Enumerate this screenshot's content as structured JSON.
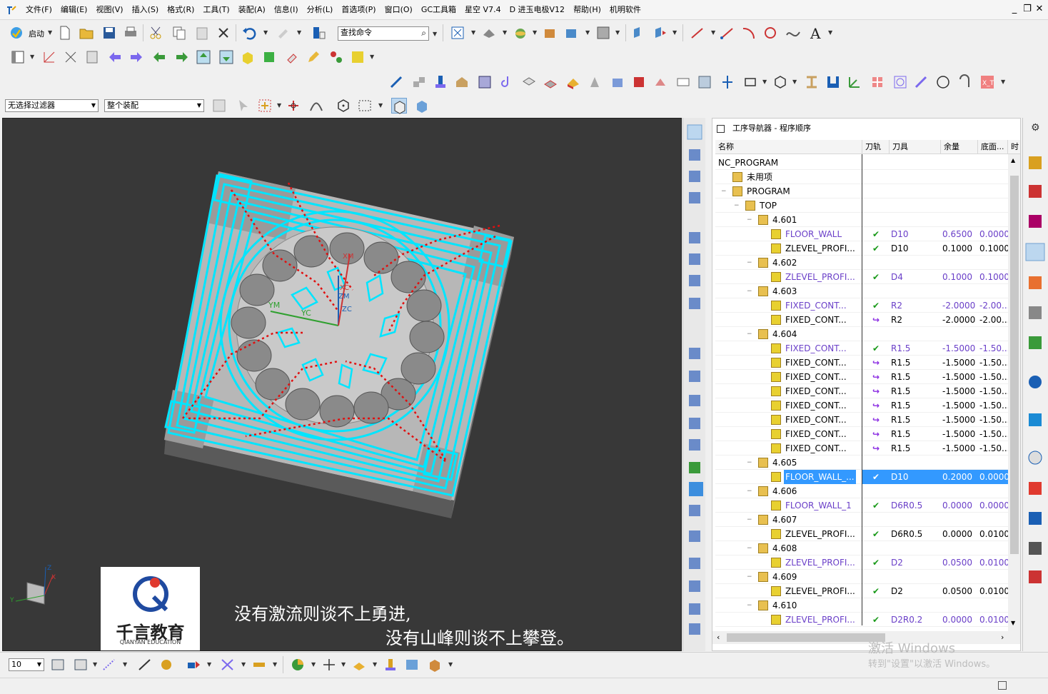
{
  "menu": {
    "items": [
      "文件(F)",
      "编辑(E)",
      "视图(V)",
      "插入(S)",
      "格式(R)",
      "工具(T)",
      "装配(A)",
      "信息(I)",
      "分析(L)",
      "首选项(P)",
      "窗口(O)",
      "GC工具箱",
      "星空 V7.4",
      "D 进玉电极V12",
      "帮助(H)",
      "机明软件"
    ],
    "window_controls": [
      "_",
      "❐",
      "✕"
    ]
  },
  "toolbar": {
    "start_label": "启动",
    "search_placeholder": "查找命令",
    "selection_filter": "无选择过滤器",
    "assembly_scope": "整个装配"
  },
  "viewport": {
    "axis_labels": {
      "xm": "XM",
      "ym": "YM",
      "yc": "YC",
      "xc": "XC",
      "zm": "ZM",
      "zc": "ZC"
    },
    "triad": {
      "x": "X",
      "y": "Y",
      "z": "Z"
    },
    "subtitle_line1": "没有激流则谈不上勇进,",
    "subtitle_line2": "没有山峰则谈不上攀登。",
    "logo_name": "千言教育",
    "logo_en": "QIANYAN EDUCATION",
    "colors": {
      "background": "#383838",
      "part": "#b4b4b4",
      "toolpath": "#00e5ff",
      "rapid": "#e01010"
    }
  },
  "navigator": {
    "title": "工序导航器 - 程序顺序",
    "columns": [
      "名称",
      "刀轨",
      "刀具",
      "余量",
      "底面...",
      "时"
    ],
    "rows": [
      {
        "level": 0,
        "type": "root",
        "name": "NC_PROGRAM",
        "check": "",
        "tool": "",
        "stock": "",
        "floor": ""
      },
      {
        "level": 1,
        "type": "group",
        "name": "未用项",
        "check": "",
        "tool": "",
        "stock": "",
        "floor": ""
      },
      {
        "level": 1,
        "type": "program",
        "name": "PROGRAM",
        "check": "",
        "tool": "",
        "stock": "",
        "floor": ""
      },
      {
        "level": 2,
        "type": "program",
        "name": "TOP",
        "check": "",
        "tool": "",
        "stock": "",
        "floor": ""
      },
      {
        "level": 3,
        "type": "program",
        "name": "4.601",
        "check": "",
        "tool": "",
        "stock": "",
        "floor": ""
      },
      {
        "level": 4,
        "type": "op",
        "name": "FLOOR_WALL",
        "check": "ok",
        "tool": "D10",
        "stock": "0.6500",
        "floor": "0.0000",
        "purple": true
      },
      {
        "level": 4,
        "type": "op",
        "name": "ZLEVEL_PROFI...",
        "check": "ok",
        "tool": "D10",
        "stock": "0.1000",
        "floor": "0.1000",
        "purple": false
      },
      {
        "level": 3,
        "type": "program",
        "name": "4.602",
        "check": "",
        "tool": "",
        "stock": "",
        "floor": ""
      },
      {
        "level": 4,
        "type": "op",
        "name": "ZLEVEL_PROFI...",
        "check": "ok",
        "tool": "D4",
        "stock": "0.1000",
        "floor": "0.1000",
        "purple": true
      },
      {
        "level": 3,
        "type": "program",
        "name": "4.603",
        "check": "",
        "tool": "",
        "stock": "",
        "floor": ""
      },
      {
        "level": 4,
        "type": "op",
        "name": "FIXED_CONT...",
        "check": "ok",
        "tool": "R2",
        "stock": "-2.0000",
        "floor": "-2.00...",
        "purple": true
      },
      {
        "level": 4,
        "type": "op",
        "name": "FIXED_CONT...",
        "check": "regen",
        "tool": "R2",
        "stock": "-2.0000",
        "floor": "-2.00...",
        "purple": false
      },
      {
        "level": 3,
        "type": "program",
        "name": "4.604",
        "check": "",
        "tool": "",
        "stock": "",
        "floor": ""
      },
      {
        "level": 4,
        "type": "op",
        "name": "FIXED_CONT...",
        "check": "ok",
        "tool": "R1.5",
        "stock": "-1.5000",
        "floor": "-1.50...",
        "purple": true
      },
      {
        "level": 4,
        "type": "op",
        "name": "FIXED_CONT...",
        "check": "regen",
        "tool": "R1.5",
        "stock": "-1.5000",
        "floor": "-1.50...",
        "purple": false
      },
      {
        "level": 4,
        "type": "op",
        "name": "FIXED_CONT...",
        "check": "regen",
        "tool": "R1.5",
        "stock": "-1.5000",
        "floor": "-1.50...",
        "purple": false
      },
      {
        "level": 4,
        "type": "op",
        "name": "FIXED_CONT...",
        "check": "regen",
        "tool": "R1.5",
        "stock": "-1.5000",
        "floor": "-1.50...",
        "purple": false
      },
      {
        "level": 4,
        "type": "op",
        "name": "FIXED_CONT...",
        "check": "regen",
        "tool": "R1.5",
        "stock": "-1.5000",
        "floor": "-1.50...",
        "purple": false
      },
      {
        "level": 4,
        "type": "op",
        "name": "FIXED_CONT...",
        "check": "regen",
        "tool": "R1.5",
        "stock": "-1.5000",
        "floor": "-1.50...",
        "purple": false
      },
      {
        "level": 4,
        "type": "op",
        "name": "FIXED_CONT...",
        "check": "regen",
        "tool": "R1.5",
        "stock": "-1.5000",
        "floor": "-1.50...",
        "purple": false
      },
      {
        "level": 4,
        "type": "op",
        "name": "FIXED_CONT...",
        "check": "regen",
        "tool": "R1.5",
        "stock": "-1.5000",
        "floor": "-1.50...",
        "purple": false
      },
      {
        "level": 3,
        "type": "program",
        "name": "4.605",
        "check": "",
        "tool": "",
        "stock": "",
        "floor": ""
      },
      {
        "level": 4,
        "type": "op",
        "name": "FLOOR_WALL_...",
        "check": "ok",
        "tool": "D10",
        "stock": "0.2000",
        "floor": "0.0000",
        "purple": true,
        "selected": true
      },
      {
        "level": 3,
        "type": "program",
        "name": "4.606",
        "check": "",
        "tool": "",
        "stock": "",
        "floor": ""
      },
      {
        "level": 4,
        "type": "op",
        "name": "FLOOR_WALL_1",
        "check": "ok",
        "tool": "D6R0.5",
        "stock": "0.0000",
        "floor": "0.0000",
        "purple": true
      },
      {
        "level": 3,
        "type": "program",
        "name": "4.607",
        "check": "",
        "tool": "",
        "stock": "",
        "floor": ""
      },
      {
        "level": 4,
        "type": "op",
        "name": "ZLEVEL_PROFI...",
        "check": "ok",
        "tool": "D6R0.5",
        "stock": "0.0000",
        "floor": "0.0100",
        "purple": false
      },
      {
        "level": 3,
        "type": "program",
        "name": "4.608",
        "check": "",
        "tool": "",
        "stock": "",
        "floor": ""
      },
      {
        "level": 4,
        "type": "op",
        "name": "ZLEVEL_PROFI...",
        "check": "ok",
        "tool": "D2",
        "stock": "0.0500",
        "floor": "0.0100",
        "purple": true
      },
      {
        "level": 3,
        "type": "program",
        "name": "4.609",
        "check": "",
        "tool": "",
        "stock": "",
        "floor": ""
      },
      {
        "level": 4,
        "type": "op",
        "name": "ZLEVEL_PROFI...",
        "check": "ok",
        "tool": "D2",
        "stock": "0.0500",
        "floor": "0.0100",
        "purple": false
      },
      {
        "level": 3,
        "type": "program",
        "name": "4.610",
        "check": "",
        "tool": "",
        "stock": "",
        "floor": ""
      },
      {
        "level": 4,
        "type": "op",
        "name": "ZLEVEL_PROFI...",
        "check": "ok",
        "tool": "D2R0.2",
        "stock": "0.0000",
        "floor": "0.0100",
        "purple": true
      }
    ]
  },
  "bottom": {
    "zoom_value": "10"
  },
  "watermark": {
    "line1": "激活 Windows",
    "line2": "转到\"设置\"以激活 Windows。"
  }
}
